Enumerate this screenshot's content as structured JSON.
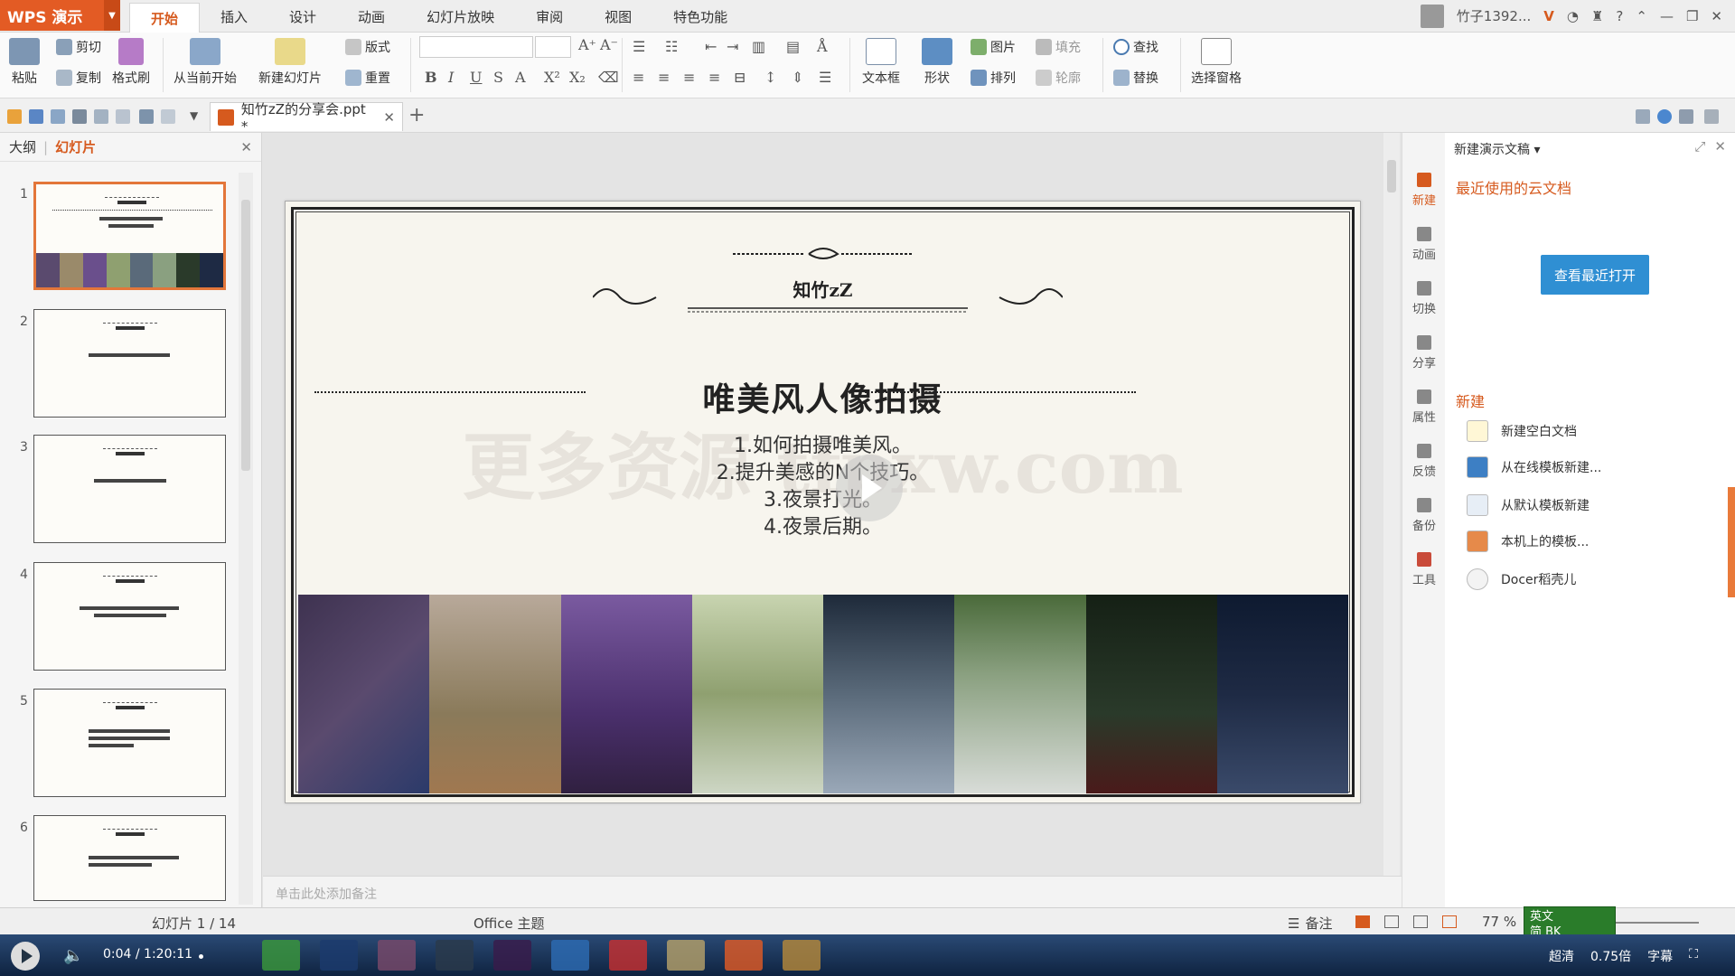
{
  "app": {
    "logo": "WPS 演示",
    "menu_tabs": [
      "开始",
      "插入",
      "设计",
      "动画",
      "幻灯片放映",
      "审阅",
      "视图",
      "特色功能"
    ],
    "active_tab": "开始",
    "user_name": "竹子1392...",
    "user_badge": "V"
  },
  "ribbon": {
    "paste": "粘贴",
    "cut": "剪切",
    "copy": "复制",
    "format_painter": "格式刷",
    "from_current": "从当前开始",
    "new_slide": "新建幻灯片",
    "layout": "版式",
    "reset": "重置",
    "textbox": "文本框",
    "shape": "形状",
    "picture": "图片",
    "fill": "填充",
    "arrange": "排列",
    "outline": "轮廓",
    "find": "查找",
    "replace": "替换",
    "selection_pane": "选择窗格",
    "format_buttons": [
      "B",
      "I",
      "U",
      "S",
      "A",
      "X²",
      "X₂"
    ]
  },
  "document": {
    "tab_title": "知竹zZ的分享会.ppt *"
  },
  "left_panel": {
    "tab_outline": "大纲",
    "tab_slides": "幻灯片",
    "thumbnails": [
      "1",
      "2",
      "3",
      "4",
      "5",
      "6"
    ]
  },
  "slide": {
    "brand": "知竹zZ",
    "title": "唯美风人像拍摄",
    "items": [
      "1.如何拍摄唯美风。",
      "2.提升美感的N个技巧。",
      "3.夜景打光。",
      "4.夜景后期。"
    ],
    "watermark": "更多资源 tfpxw.com",
    "photo_colors": [
      "#5a4a6e",
      "#9a8a6a",
      "#6a4f8c",
      "#8fa070",
      "#5a6a7a",
      "#8aa080",
      "#2a3a2a",
      "#1e2a44"
    ]
  },
  "notes_placeholder": "单击此处添加备注",
  "right_pane": {
    "header": "新建演示文稿",
    "recent_section": "最近使用的云文档",
    "recent_button": "查看最近打开",
    "new_section": "新建",
    "new_items": [
      "新建空白文档",
      "从在线模板新建...",
      "从默认模板新建",
      "本机上的模板...",
      "Docer稻壳儿"
    ],
    "nav": [
      "新建",
      "动画",
      "切换",
      "分享",
      "属性",
      "反馈",
      "备份",
      "工具"
    ]
  },
  "status": {
    "slide_counter": "幻灯片 1 / 14",
    "theme": "Office 主题",
    "notes": "备注",
    "zoom": "77 %"
  },
  "ime": {
    "line1": "英文",
    "line2": "简 BK"
  },
  "player": {
    "time": "0:04 / 1:20:11",
    "quality": "超清",
    "speed": "0.75倍",
    "subtitle": "字幕"
  },
  "colors": {
    "accent": "#d65a1e",
    "wps_orange": "#e35b24",
    "cloud_button": "#2f8fd3"
  }
}
